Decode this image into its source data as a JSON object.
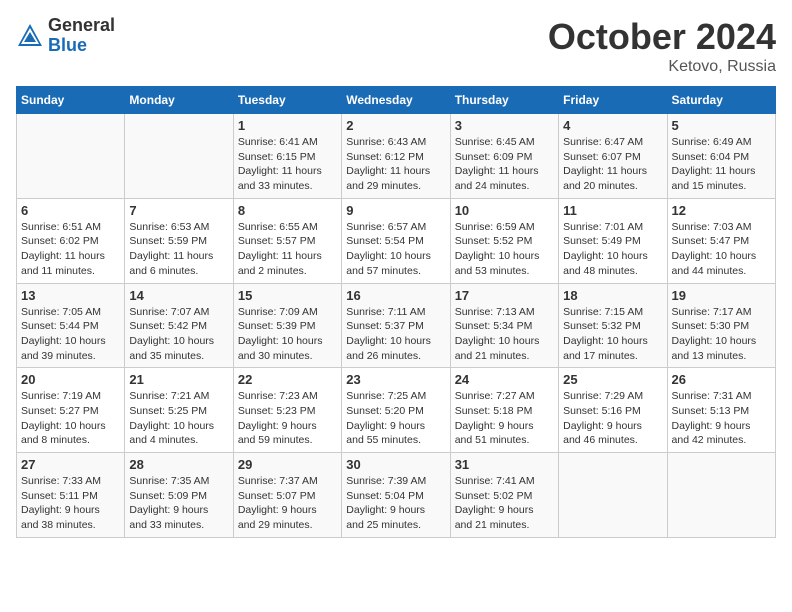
{
  "header": {
    "logo_general": "General",
    "logo_blue": "Blue",
    "title": "October 2024",
    "location": "Ketovo, Russia"
  },
  "weekdays": [
    "Sunday",
    "Monday",
    "Tuesday",
    "Wednesday",
    "Thursday",
    "Friday",
    "Saturday"
  ],
  "rows": [
    [
      {
        "day": "",
        "info": ""
      },
      {
        "day": "",
        "info": ""
      },
      {
        "day": "1",
        "info": "Sunrise: 6:41 AM\nSunset: 6:15 PM\nDaylight: 11 hours\nand 33 minutes."
      },
      {
        "day": "2",
        "info": "Sunrise: 6:43 AM\nSunset: 6:12 PM\nDaylight: 11 hours\nand 29 minutes."
      },
      {
        "day": "3",
        "info": "Sunrise: 6:45 AM\nSunset: 6:09 PM\nDaylight: 11 hours\nand 24 minutes."
      },
      {
        "day": "4",
        "info": "Sunrise: 6:47 AM\nSunset: 6:07 PM\nDaylight: 11 hours\nand 20 minutes."
      },
      {
        "day": "5",
        "info": "Sunrise: 6:49 AM\nSunset: 6:04 PM\nDaylight: 11 hours\nand 15 minutes."
      }
    ],
    [
      {
        "day": "6",
        "info": "Sunrise: 6:51 AM\nSunset: 6:02 PM\nDaylight: 11 hours\nand 11 minutes."
      },
      {
        "day": "7",
        "info": "Sunrise: 6:53 AM\nSunset: 5:59 PM\nDaylight: 11 hours\nand 6 minutes."
      },
      {
        "day": "8",
        "info": "Sunrise: 6:55 AM\nSunset: 5:57 PM\nDaylight: 11 hours\nand 2 minutes."
      },
      {
        "day": "9",
        "info": "Sunrise: 6:57 AM\nSunset: 5:54 PM\nDaylight: 10 hours\nand 57 minutes."
      },
      {
        "day": "10",
        "info": "Sunrise: 6:59 AM\nSunset: 5:52 PM\nDaylight: 10 hours\nand 53 minutes."
      },
      {
        "day": "11",
        "info": "Sunrise: 7:01 AM\nSunset: 5:49 PM\nDaylight: 10 hours\nand 48 minutes."
      },
      {
        "day": "12",
        "info": "Sunrise: 7:03 AM\nSunset: 5:47 PM\nDaylight: 10 hours\nand 44 minutes."
      }
    ],
    [
      {
        "day": "13",
        "info": "Sunrise: 7:05 AM\nSunset: 5:44 PM\nDaylight: 10 hours\nand 39 minutes."
      },
      {
        "day": "14",
        "info": "Sunrise: 7:07 AM\nSunset: 5:42 PM\nDaylight: 10 hours\nand 35 minutes."
      },
      {
        "day": "15",
        "info": "Sunrise: 7:09 AM\nSunset: 5:39 PM\nDaylight: 10 hours\nand 30 minutes."
      },
      {
        "day": "16",
        "info": "Sunrise: 7:11 AM\nSunset: 5:37 PM\nDaylight: 10 hours\nand 26 minutes."
      },
      {
        "day": "17",
        "info": "Sunrise: 7:13 AM\nSunset: 5:34 PM\nDaylight: 10 hours\nand 21 minutes."
      },
      {
        "day": "18",
        "info": "Sunrise: 7:15 AM\nSunset: 5:32 PM\nDaylight: 10 hours\nand 17 minutes."
      },
      {
        "day": "19",
        "info": "Sunrise: 7:17 AM\nSunset: 5:30 PM\nDaylight: 10 hours\nand 13 minutes."
      }
    ],
    [
      {
        "day": "20",
        "info": "Sunrise: 7:19 AM\nSunset: 5:27 PM\nDaylight: 10 hours\nand 8 minutes."
      },
      {
        "day": "21",
        "info": "Sunrise: 7:21 AM\nSunset: 5:25 PM\nDaylight: 10 hours\nand 4 minutes."
      },
      {
        "day": "22",
        "info": "Sunrise: 7:23 AM\nSunset: 5:23 PM\nDaylight: 9 hours\nand 59 minutes."
      },
      {
        "day": "23",
        "info": "Sunrise: 7:25 AM\nSunset: 5:20 PM\nDaylight: 9 hours\nand 55 minutes."
      },
      {
        "day": "24",
        "info": "Sunrise: 7:27 AM\nSunset: 5:18 PM\nDaylight: 9 hours\nand 51 minutes."
      },
      {
        "day": "25",
        "info": "Sunrise: 7:29 AM\nSunset: 5:16 PM\nDaylight: 9 hours\nand 46 minutes."
      },
      {
        "day": "26",
        "info": "Sunrise: 7:31 AM\nSunset: 5:13 PM\nDaylight: 9 hours\nand 42 minutes."
      }
    ],
    [
      {
        "day": "27",
        "info": "Sunrise: 7:33 AM\nSunset: 5:11 PM\nDaylight: 9 hours\nand 38 minutes."
      },
      {
        "day": "28",
        "info": "Sunrise: 7:35 AM\nSunset: 5:09 PM\nDaylight: 9 hours\nand 33 minutes."
      },
      {
        "day": "29",
        "info": "Sunrise: 7:37 AM\nSunset: 5:07 PM\nDaylight: 9 hours\nand 29 minutes."
      },
      {
        "day": "30",
        "info": "Sunrise: 7:39 AM\nSunset: 5:04 PM\nDaylight: 9 hours\nand 25 minutes."
      },
      {
        "day": "31",
        "info": "Sunrise: 7:41 AM\nSunset: 5:02 PM\nDaylight: 9 hours\nand 21 minutes."
      },
      {
        "day": "",
        "info": ""
      },
      {
        "day": "",
        "info": ""
      }
    ]
  ]
}
